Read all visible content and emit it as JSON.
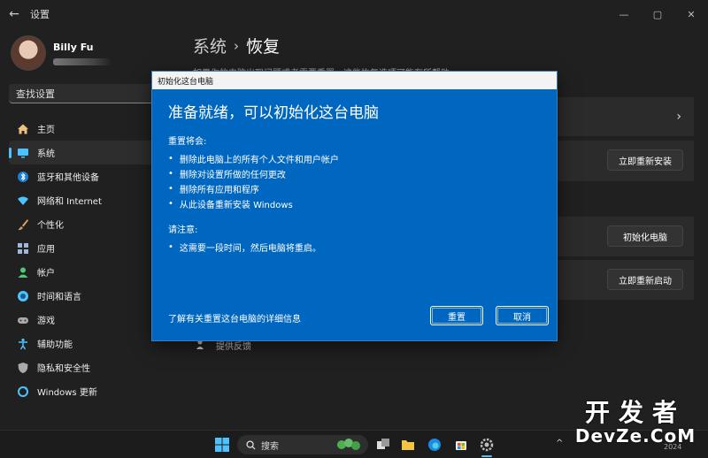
{
  "window": {
    "title": "设置",
    "back_icon": "arrow-left-icon",
    "controls": [
      "—",
      "▢",
      "✕"
    ]
  },
  "user": {
    "name": "Billy Fu"
  },
  "search": {
    "placeholder": "查找设置"
  },
  "sidebar": {
    "items": [
      {
        "label": "主页",
        "icon": "home-icon",
        "color": "#f0c080"
      },
      {
        "label": "系统",
        "icon": "monitor-icon",
        "color": "#4cc2ff",
        "active": true
      },
      {
        "label": "蓝牙和其他设备",
        "icon": "bluetooth-icon",
        "color": "#4cc2ff"
      },
      {
        "label": "网络和 Internet",
        "icon": "wifi-icon",
        "color": "#4cc2ff"
      },
      {
        "label": "个性化",
        "icon": "brush-icon",
        "color": "#e8a05a"
      },
      {
        "label": "应用",
        "icon": "apps-icon",
        "color": "#9fb8d8"
      },
      {
        "label": "帐户",
        "icon": "person-icon",
        "color": "#50c878"
      },
      {
        "label": "时间和语言",
        "icon": "globe-clock-icon",
        "color": "#4cc2ff"
      },
      {
        "label": "游戏",
        "icon": "gamepad-icon",
        "color": "#aaaaaa"
      },
      {
        "label": "辅助功能",
        "icon": "accessibility-icon",
        "color": "#4cc2ff"
      },
      {
        "label": "隐私和安全性",
        "icon": "shield-icon",
        "color": "#aaaaaa"
      },
      {
        "label": "Windows 更新",
        "icon": "update-icon",
        "color": "#4cc2ff"
      }
    ]
  },
  "main": {
    "breadcrumb_parent": "系统",
    "breadcrumb_separator": "›",
    "page_title": "恢复",
    "description": "如果你的电脑出现问题或者需要重置，这些恢复选项可能有所帮助",
    "cards": {
      "reinstall_button": "立即重新安装",
      "reset_button": "初始化电脑",
      "restart_button": "立即重新启动"
    },
    "feedback": "提供反馈"
  },
  "dialog": {
    "title": "初始化这台电脑",
    "heading": "准备就绪，可以初始化这台电脑",
    "will_label": "重置将会:",
    "will_items": [
      "删除此电脑上的所有个人文件和用户帐户",
      "删除对设置所做的任何更改",
      "删除所有应用和程序",
      "从此设备重新安装 Windows"
    ],
    "note_label": "请注意:",
    "note_items": [
      "这需要一段时间，然后电脑将重启。"
    ],
    "link": "了解有关重置这台电脑的详细信息",
    "reset_button": "重置",
    "cancel_button": "取消"
  },
  "taskbar": {
    "search_label": "搜索",
    "tray_chevron": "^",
    "time": "2024"
  },
  "watermark": {
    "top": "开发者",
    "bottom": "DevZe.CoM"
  }
}
